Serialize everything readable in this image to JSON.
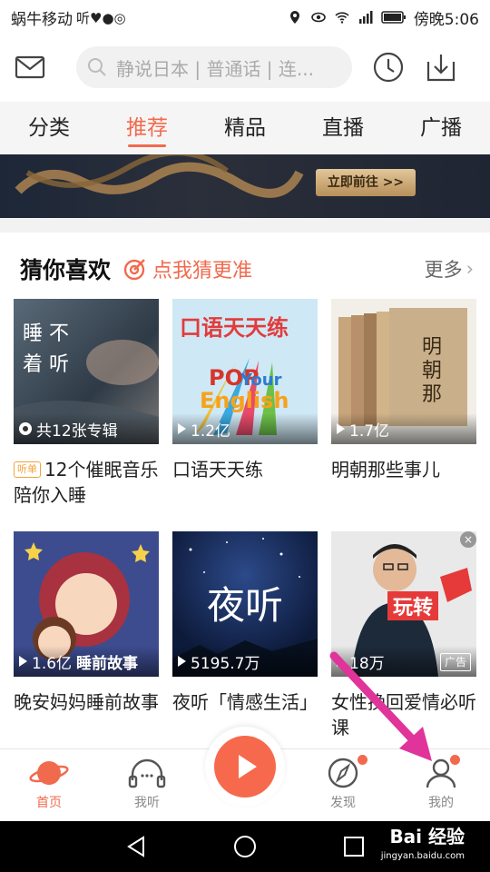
{
  "status_bar": {
    "carrier": "蜗牛移动",
    "time_label": "傍晚5:06"
  },
  "header": {
    "search_placeholder": "静说日本 | 普通话 | 连..."
  },
  "tabs": [
    {
      "label": "分类"
    },
    {
      "label": "推荐"
    },
    {
      "label": "精品"
    },
    {
      "label": "直播"
    },
    {
      "label": "广播"
    }
  ],
  "banner": {
    "button_label": "立即前往 >>"
  },
  "section": {
    "title": "猜你喜欢",
    "subtitle": "点我猜更准",
    "more_label": "更多"
  },
  "cards": [
    {
      "title": "12个催眠音乐陪你入睡",
      "tag": "听单",
      "meta": "共12张专辑",
      "cover_text": "睡 不 着 听"
    },
    {
      "title": "口语天天练",
      "meta": "1.2亿",
      "cover_text": "口语天天练"
    },
    {
      "title": "明朝那些事儿",
      "meta": "1.7亿",
      "cover_text": "明朝那些事儿"
    },
    {
      "title": "晚安妈妈睡前故事",
      "meta": "1.6亿",
      "cover_caption": "睡前故事"
    },
    {
      "title": "夜听「情感生活」",
      "meta": "5195.7万",
      "cover_text": "夜听"
    },
    {
      "title": "女性挽回爱情必听课",
      "meta": "18万",
      "cover_text": "玩转",
      "ad_label": "广告"
    }
  ],
  "bottom_nav": [
    {
      "label": "首页"
    },
    {
      "label": "我听"
    },
    {
      "label": "发现"
    },
    {
      "label": "我的"
    }
  ],
  "colors": {
    "accent": "#f26a4e",
    "tab_bg": "#f5f5f5"
  },
  "watermark": {
    "brand": "Bai 经验",
    "url": "jingyan.baidu.com"
  }
}
